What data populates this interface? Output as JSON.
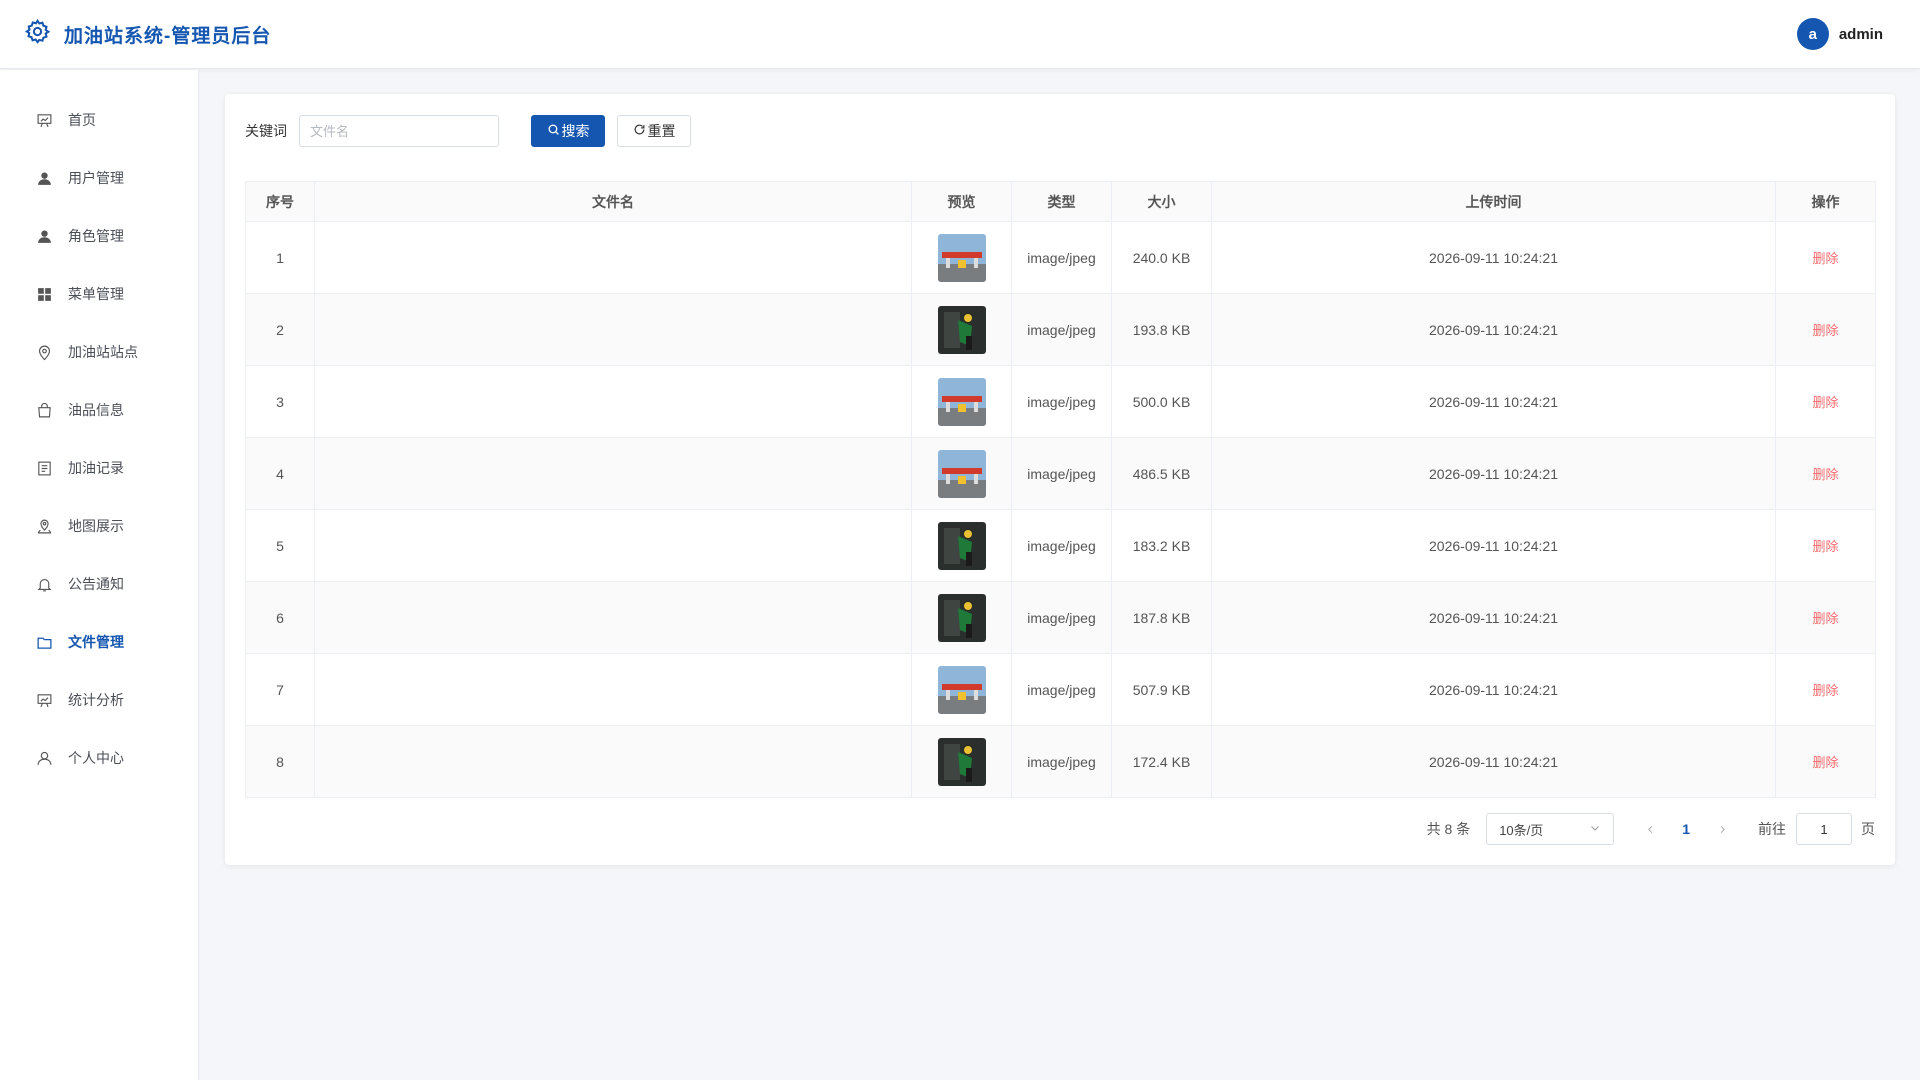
{
  "header": {
    "title": "加油站系统-管理员后台",
    "avatar_letter": "a",
    "username": "admin",
    "accent_color": "#1557b0"
  },
  "sidebar": {
    "items": [
      {
        "label": "首页",
        "icon": "chart-board-icon",
        "active": false
      },
      {
        "label": "用户管理",
        "icon": "user-filled-icon",
        "active": false
      },
      {
        "label": "角色管理",
        "icon": "user-filled-icon",
        "active": false
      },
      {
        "label": "菜单管理",
        "icon": "grid-icon",
        "active": false
      },
      {
        "label": "加油站站点",
        "icon": "location-pin-icon",
        "active": false
      },
      {
        "label": "油品信息",
        "icon": "shopping-bag-icon",
        "active": false
      },
      {
        "label": "加油记录",
        "icon": "document-icon",
        "active": false
      },
      {
        "label": "地图展示",
        "icon": "map-location-icon",
        "active": false
      },
      {
        "label": "公告通知",
        "icon": "bell-icon",
        "active": false
      },
      {
        "label": "文件管理",
        "icon": "folder-icon",
        "active": true
      },
      {
        "label": "统计分析",
        "icon": "chart-board-icon",
        "active": false
      },
      {
        "label": "个人中心",
        "icon": "user-outline-icon",
        "active": false
      }
    ]
  },
  "search": {
    "keyword_label": "关键词",
    "placeholder": "文件名",
    "value": "",
    "search_label": "搜索",
    "reset_label": "重置"
  },
  "table": {
    "columns": [
      "序号",
      "文件名",
      "预览",
      "类型",
      "大小",
      "上传时间",
      "操作"
    ],
    "rows": [
      {
        "index": "1",
        "name": "",
        "preview": "gas-station-photo-thumbnail",
        "type": "image/jpeg",
        "size": "240.0 KB",
        "uploaded": "2026-09-11 10:24:21",
        "action": "删除"
      },
      {
        "index": "2",
        "name": "",
        "preview": "fuel-nozzle-photo-thumbnail",
        "type": "image/jpeg",
        "size": "193.8 KB",
        "uploaded": "2026-09-11 10:24:21",
        "action": "删除"
      },
      {
        "index": "3",
        "name": "",
        "preview": "gas-station-photo-thumbnail",
        "type": "image/jpeg",
        "size": "500.0 KB",
        "uploaded": "2026-09-11 10:24:21",
        "action": "删除"
      },
      {
        "index": "4",
        "name": "",
        "preview": "gas-station-photo-thumbnail",
        "type": "image/jpeg",
        "size": "486.5 KB",
        "uploaded": "2026-09-11 10:24:21",
        "action": "删除"
      },
      {
        "index": "5",
        "name": "",
        "preview": "fuel-nozzle-photo-thumbnail",
        "type": "image/jpeg",
        "size": "183.2 KB",
        "uploaded": "2026-09-11 10:24:21",
        "action": "删除"
      },
      {
        "index": "6",
        "name": "",
        "preview": "fuel-nozzle-photo-thumbnail",
        "type": "image/jpeg",
        "size": "187.8 KB",
        "uploaded": "2026-09-11 10:24:21",
        "action": "删除"
      },
      {
        "index": "7",
        "name": "",
        "preview": "gas-station-photo-thumbnail",
        "type": "image/jpeg",
        "size": "507.9 KB",
        "uploaded": "2026-09-11 10:24:21",
        "action": "删除"
      },
      {
        "index": "8",
        "name": "",
        "preview": "fuel-nozzle-photo-thumbnail",
        "type": "image/jpeg",
        "size": "172.4 KB",
        "uploaded": "2026-09-11 10:24:21",
        "action": "删除"
      }
    ]
  },
  "pagination": {
    "total_text": "共 8 条",
    "page_size": "10条/页",
    "current_page": "1",
    "goto_label": "前往",
    "goto_value": "1",
    "page_suffix": "页"
  },
  "colors": {
    "primary": "#1557b0",
    "danger": "#f56c6c",
    "background": "#f4f6f9"
  }
}
